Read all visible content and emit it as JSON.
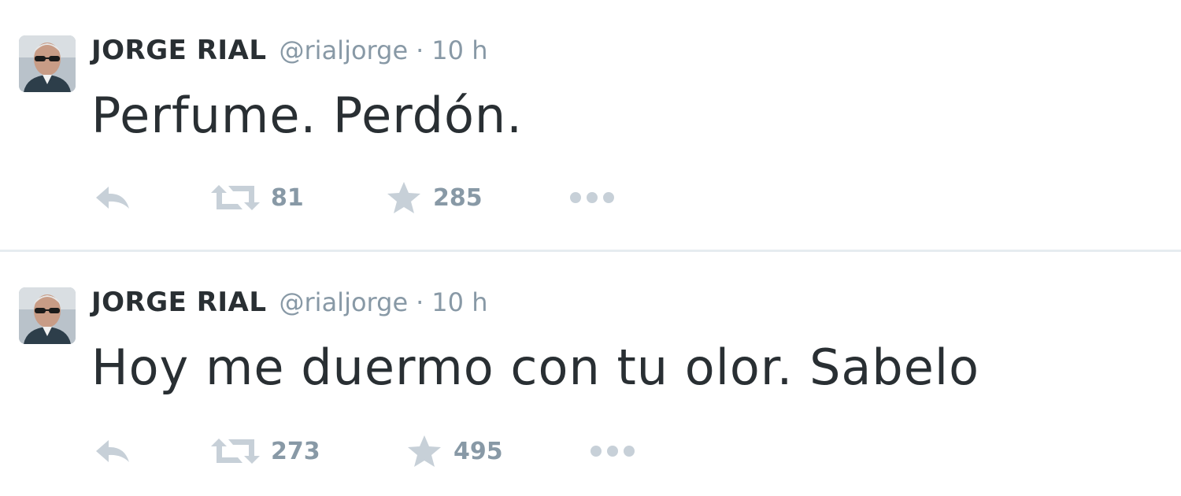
{
  "tweets": [
    {
      "author_name": "JORGE RIAL",
      "handle": "@rialjorge",
      "separator": "·",
      "time": "10 h",
      "text": "Perfume. Perdón.",
      "retweets": "81",
      "favorites": "285",
      "icons": {
        "reply": "reply-icon",
        "retweet": "retweet-icon",
        "favorite": "star-icon",
        "more": "more-dots-icon"
      }
    },
    {
      "author_name": "JORGE RIAL",
      "handle": "@rialjorge",
      "separator": "·",
      "time": "10 h",
      "text": "Hoy me duermo con tu olor. Sabelo",
      "retweets": "273",
      "favorites": "495",
      "icons": {
        "reply": "reply-icon",
        "retweet": "retweet-icon",
        "favorite": "star-icon",
        "more": "more-dots-icon"
      }
    }
  ],
  "colors": {
    "text": "#292f33",
    "muted": "#8899a6",
    "icon": "#c7d0d8",
    "divider": "#e6ecf0"
  }
}
